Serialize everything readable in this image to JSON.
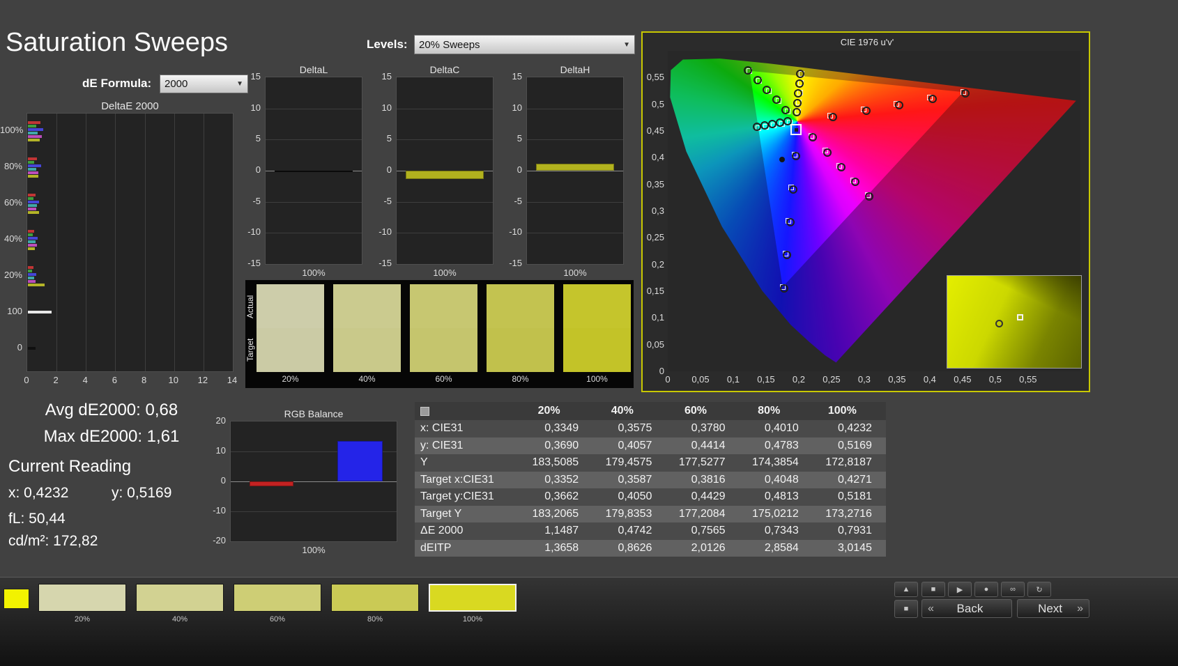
{
  "app": {
    "title": "Saturation Sweeps"
  },
  "controls": {
    "de_formula_label": "dE Formula:",
    "de_formula_value": "2000",
    "levels_label": "Levels:",
    "levels_value": "20% Sweeps"
  },
  "charts": {
    "delta_e": {
      "title": "DeltaE 2000",
      "x_max": 14,
      "x_ticks": [
        "0",
        "2",
        "4",
        "6",
        "8",
        "10",
        "12",
        "14"
      ],
      "groups": [
        {
          "label": "100%",
          "bars": [
            {
              "c": "#c03535",
              "v": 0.85
            },
            {
              "c": "#3f9e3f",
              "v": 0.55
            },
            {
              "c": "#4646d8",
              "v": 1.05
            },
            {
              "c": "#40a8a8",
              "v": 0.65
            },
            {
              "c": "#bb4ebb",
              "v": 0.95
            },
            {
              "c": "#b4b428",
              "v": 0.79
            }
          ]
        },
        {
          "label": "80%",
          "bars": [
            {
              "c": "#c03535",
              "v": 0.6
            },
            {
              "c": "#3f9e3f",
              "v": 0.45
            },
            {
              "c": "#4646d8",
              "v": 0.9
            },
            {
              "c": "#40a8a8",
              "v": 0.55
            },
            {
              "c": "#bb4ebb",
              "v": 0.7
            },
            {
              "c": "#b4b428",
              "v": 0.73
            }
          ]
        },
        {
          "label": "60%",
          "bars": [
            {
              "c": "#c03535",
              "v": 0.5
            },
            {
              "c": "#3f9e3f",
              "v": 0.4
            },
            {
              "c": "#4646d8",
              "v": 0.75
            },
            {
              "c": "#40a8a8",
              "v": 0.6
            },
            {
              "c": "#bb4ebb",
              "v": 0.55
            },
            {
              "c": "#b4b428",
              "v": 0.76
            }
          ]
        },
        {
          "label": "40%",
          "bars": [
            {
              "c": "#c03535",
              "v": 0.45
            },
            {
              "c": "#3f9e3f",
              "v": 0.35
            },
            {
              "c": "#4646d8",
              "v": 0.65
            },
            {
              "c": "#40a8a8",
              "v": 0.5
            },
            {
              "c": "#bb4ebb",
              "v": 0.6
            },
            {
              "c": "#b4b428",
              "v": 0.47
            }
          ]
        },
        {
          "label": "20%",
          "bars": [
            {
              "c": "#c03535",
              "v": 0.4
            },
            {
              "c": "#3f9e3f",
              "v": 0.3
            },
            {
              "c": "#4646d8",
              "v": 0.55
            },
            {
              "c": "#40a8a8",
              "v": 0.45
            },
            {
              "c": "#bb4ebb",
              "v": 0.5
            },
            {
              "c": "#b4b428",
              "v": 1.15
            }
          ]
        },
        {
          "label": "100",
          "bars": [
            {
              "c": "#e8e8e8",
              "v": 1.61
            }
          ]
        },
        {
          "label": "0",
          "bars": [
            {
              "c": "#101010",
              "v": 0.5
            }
          ]
        }
      ]
    },
    "delta_axis": {
      "ticks": [
        "15",
        "10",
        "5",
        "0",
        "-5",
        "-10",
        "-15"
      ],
      "max": 15,
      "x_label": "100%"
    },
    "delta_l": {
      "title": "DeltaL",
      "value": -0.12,
      "color": "#101010"
    },
    "delta_c": {
      "title": "DeltaC",
      "value": -1.35,
      "color": "#b2b21e"
    },
    "delta_h": {
      "title": "DeltaH",
      "value": 1.1,
      "color": "#b2b21e"
    },
    "rgb_balance": {
      "title": "RGB Balance",
      "max": 20,
      "ticks": [
        "20",
        "10",
        "0",
        "-10",
        "-20"
      ],
      "x_label": "100%",
      "bars": [
        {
          "name": "red",
          "c": "#c32222",
          "v": -1.6
        },
        {
          "name": "green",
          "c": "#2ba52b",
          "v": 0
        },
        {
          "name": "blue",
          "c": "#2424e8",
          "v": 13.5
        }
      ]
    }
  },
  "sweep_swatches": {
    "row_labels": [
      "Actual",
      "Target"
    ],
    "items": [
      {
        "label": "20%",
        "actual": "#cdcdaa",
        "target": "#cbcba5"
      },
      {
        "label": "40%",
        "actual": "#cbcb8f",
        "target": "#c9c98a"
      },
      {
        "label": "60%",
        "actual": "#c7c771",
        "target": "#c5c56d"
      },
      {
        "label": "80%",
        "actual": "#c3c350",
        "target": "#c1c14c"
      },
      {
        "label": "100%",
        "actual": "#c5c52c",
        "target": "#c3c328"
      }
    ]
  },
  "cie": {
    "title": "CIE 1976 u'v'",
    "u_max": 0.63,
    "v_max": 0.6,
    "tick_vals": [
      0,
      0.05,
      0.1,
      0.15,
      0.2,
      0.25,
      0.3,
      0.35,
      0.4,
      0.45,
      0.5,
      0.55
    ],
    "tick_labels": [
      "0",
      "0,05",
      "0,1",
      "0,15",
      "0,2",
      "0,25",
      "0,3",
      "0,35",
      "0,4",
      "0,45",
      "0,5",
      "0,55"
    ],
    "white_point": [
      0.1978,
      0.4683
    ],
    "locus": [
      [
        0.2569,
        0.0165
      ],
      [
        0.24,
        0.03
      ],
      [
        0.2161,
        0.0549
      ],
      [
        0.1877,
        0.0871
      ],
      [
        0.1441,
        0.151
      ],
      [
        0.0828,
        0.2708
      ],
      [
        0.0282,
        0.4117
      ],
      [
        0.0035,
        0.5131
      ],
      [
        0.0046,
        0.5638
      ],
      [
        0.0231,
        0.5837
      ],
      [
        0.0792,
        0.5856
      ],
      [
        0.1531,
        0.5766
      ],
      [
        0.2623,
        0.5604
      ],
      [
        0.4035,
        0.5393
      ],
      [
        0.5203,
        0.5219
      ],
      [
        0.6234,
        0.5065
      ]
    ],
    "triangle": [
      [
        0.4507,
        0.5229
      ],
      [
        0.125,
        0.5625
      ],
      [
        0.1754,
        0.1579
      ]
    ],
    "targets": [
      [
        0.2484,
        0.4792
      ],
      [
        0.299,
        0.4901
      ],
      [
        0.3495,
        0.5011
      ],
      [
        0.4001,
        0.512
      ],
      [
        0.4507,
        0.5229
      ],
      [
        0.1832,
        0.4871
      ],
      [
        0.1687,
        0.506
      ],
      [
        0.1541,
        0.5248
      ],
      [
        0.1396,
        0.5437
      ],
      [
        0.125,
        0.5625
      ],
      [
        0.1933,
        0.4062
      ],
      [
        0.1888,
        0.3441
      ],
      [
        0.1844,
        0.2821
      ],
      [
        0.1799,
        0.22
      ],
      [
        0.1754,
        0.1579
      ],
      [
        0.1859,
        0.4657
      ],
      [
        0.174,
        0.4632
      ],
      [
        0.1621,
        0.4606
      ],
      [
        0.1502,
        0.4581
      ],
      [
        0.1383,
        0.4555
      ],
      [
        0.2192,
        0.4406
      ],
      [
        0.2407,
        0.4129
      ],
      [
        0.2621,
        0.3852
      ],
      [
        0.2836,
        0.3575
      ],
      [
        0.305,
        0.3298
      ],
      [
        0.1991,
        0.4862
      ],
      [
        0.2004,
        0.504
      ],
      [
        0.2017,
        0.5219
      ],
      [
        0.203,
        0.5397
      ],
      [
        0.2043,
        0.5576
      ]
    ],
    "measured": [
      [
        0.2521,
        0.476
      ],
      [
        0.3034,
        0.4875
      ],
      [
        0.3532,
        0.4988
      ],
      [
        0.4049,
        0.5095
      ],
      [
        0.4544,
        0.5205
      ],
      [
        0.1801,
        0.4895
      ],
      [
        0.166,
        0.5082
      ],
      [
        0.1512,
        0.527
      ],
      [
        0.137,
        0.5455
      ],
      [
        0.1228,
        0.564
      ],
      [
        0.1956,
        0.403
      ],
      [
        0.1912,
        0.341
      ],
      [
        0.1868,
        0.279
      ],
      [
        0.1822,
        0.2172
      ],
      [
        0.1779,
        0.1555
      ],
      [
        0.1835,
        0.468
      ],
      [
        0.1716,
        0.4655
      ],
      [
        0.1598,
        0.463
      ],
      [
        0.1479,
        0.4604
      ],
      [
        0.136,
        0.4578
      ],
      [
        0.2216,
        0.438
      ],
      [
        0.2432,
        0.4102
      ],
      [
        0.2647,
        0.3826
      ],
      [
        0.2861,
        0.3549
      ],
      [
        0.3075,
        0.3272
      ],
      [
        0.1968,
        0.485
      ],
      [
        0.1981,
        0.5028
      ],
      [
        0.1994,
        0.5207
      ],
      [
        0.2007,
        0.5385
      ],
      [
        0.2026,
        0.5567
      ]
    ],
    "selected": [
      0.196,
      0.452
    ],
    "current_dot": [
      0.175,
      0.397
    ]
  },
  "stats": {
    "avg": "Avg dE2000: 0,68",
    "max": "Max dE2000: 1,61",
    "current_reading_label": "Current Reading",
    "x": "x: 0,4232",
    "y": "y: 0,5169",
    "fl": "fL: 50,44",
    "cdm2": "cd/m²: 172,82"
  },
  "table": {
    "columns": [
      "20%",
      "40%",
      "60%",
      "80%",
      "100%"
    ],
    "rows": [
      {
        "label": "x: CIE31",
        "values": [
          "0,3349",
          "0,3575",
          "0,3780",
          "0,4010",
          "0,4232"
        ]
      },
      {
        "label": "y: CIE31",
        "values": [
          "0,3690",
          "0,4057",
          "0,4414",
          "0,4783",
          "0,5169"
        ]
      },
      {
        "label": "Y",
        "values": [
          "183,5085",
          "179,4575",
          "177,5277",
          "174,3854",
          "172,8187"
        ]
      },
      {
        "label": "Target x:CIE31",
        "values": [
          "0,3352",
          "0,3587",
          "0,3816",
          "0,4048",
          "0,4271"
        ]
      },
      {
        "label": "Target y:CIE31",
        "values": [
          "0,3662",
          "0,4050",
          "0,4429",
          "0,4813",
          "0,5181"
        ]
      },
      {
        "label": "Target Y",
        "values": [
          "183,2065",
          "179,8353",
          "177,2084",
          "175,0212",
          "173,2716"
        ]
      },
      {
        "label": "ΔE 2000",
        "values": [
          "1,1487",
          "0,4742",
          "0,7565",
          "0,7343",
          "0,7931"
        ]
      },
      {
        "label": "dEITP",
        "values": [
          "1,3658",
          "0,8626",
          "2,0126",
          "2,8584",
          "3,0145"
        ]
      }
    ]
  },
  "bottom": {
    "pattern_color": "#f2f200",
    "swatches": [
      {
        "label": "20%",
        "color": "#d6d6ae",
        "selected": false
      },
      {
        "label": "40%",
        "color": "#d2d292",
        "selected": false
      },
      {
        "label": "60%",
        "color": "#cece75",
        "selected": false
      },
      {
        "label": "80%",
        "color": "#caca55",
        "selected": false
      },
      {
        "label": "100%",
        "color": "#d9d921",
        "selected": true
      }
    ],
    "stack_buttons": [
      "▲",
      "■"
    ],
    "transport_buttons": [
      "■",
      "▶",
      "●",
      "∞",
      "↻"
    ],
    "back": "Back",
    "next": "Next",
    "chev_left": "«",
    "chev_right": "»"
  }
}
